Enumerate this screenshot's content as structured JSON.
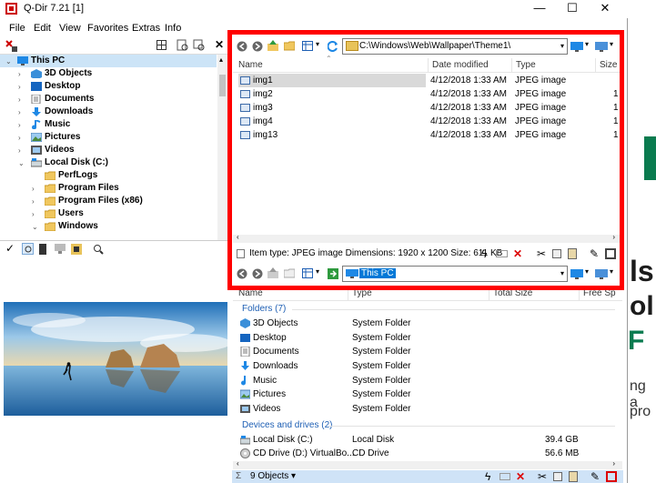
{
  "window": {
    "title": "Q-Dir 7.21 [1]",
    "minimize": "—",
    "maximize": "☐",
    "close": "✕"
  },
  "menu": [
    "File",
    "Edit",
    "View",
    "Favorites",
    "Extras",
    "Info"
  ],
  "tree": {
    "items": [
      {
        "label": "This PC",
        "level": 0,
        "expanded": true,
        "selected": true,
        "icon": "monitor-icon"
      },
      {
        "label": "3D Objects",
        "level": 1,
        "icon": "cube-icon"
      },
      {
        "label": "Desktop",
        "level": 1,
        "icon": "desktop-icon"
      },
      {
        "label": "Documents",
        "level": 1,
        "icon": "documents-icon"
      },
      {
        "label": "Downloads",
        "level": 1,
        "icon": "download-arrow-icon"
      },
      {
        "label": "Music",
        "level": 1,
        "icon": "music-note-icon"
      },
      {
        "label": "Pictures",
        "level": 1,
        "icon": "pictures-icon"
      },
      {
        "label": "Videos",
        "level": 1,
        "icon": "videos-icon"
      },
      {
        "label": "Local Disk (C:)",
        "level": 1,
        "expanded": true,
        "icon": "drive-icon"
      },
      {
        "label": "PerfLogs",
        "level": 2,
        "icon": "folder-icon"
      },
      {
        "label": "Program Files",
        "level": 2,
        "icon": "folder-icon"
      },
      {
        "label": "Program Files (x86)",
        "level": 2,
        "icon": "folder-icon"
      },
      {
        "label": "Users",
        "level": 2,
        "icon": "folder-icon"
      },
      {
        "label": "Windows",
        "level": 2,
        "expanded": true,
        "icon": "folder-icon"
      }
    ]
  },
  "pane1": {
    "address": "C:\\Windows\\Web\\Wallpaper\\Theme1\\",
    "columns": [
      "Name",
      "Date modified",
      "Type",
      "Size"
    ],
    "files": [
      {
        "name": "img1",
        "date": "4/12/2018 1:33 AM",
        "type": "JPEG image",
        "size": ""
      },
      {
        "name": "img2",
        "date": "4/12/2018 1:33 AM",
        "type": "JPEG image",
        "size": "1"
      },
      {
        "name": "img3",
        "date": "4/12/2018 1:33 AM",
        "type": "JPEG image",
        "size": "1"
      },
      {
        "name": "img4",
        "date": "4/12/2018 1:33 AM",
        "type": "JPEG image",
        "size": "1"
      },
      {
        "name": "img13",
        "date": "4/12/2018 1:33 AM",
        "type": "JPEG image",
        "size": "1"
      }
    ],
    "status": "Item type: JPEG image Dimensions: 1920 x 1200 Size: 611 KB"
  },
  "pane2": {
    "address": "This PC",
    "columns": [
      "Name",
      "Type",
      "Total Size",
      "Free Sp"
    ],
    "group_folders": "Folders (7)",
    "folders": [
      {
        "name": "3D Objects",
        "type": "System Folder",
        "icon": "cube-icon"
      },
      {
        "name": "Desktop",
        "type": "System Folder",
        "icon": "desktop-icon"
      },
      {
        "name": "Documents",
        "type": "System Folder",
        "icon": "documents-icon"
      },
      {
        "name": "Downloads",
        "type": "System Folder",
        "icon": "download-arrow-icon"
      },
      {
        "name": "Music",
        "type": "System Folder",
        "icon": "music-note-icon"
      },
      {
        "name": "Pictures",
        "type": "System Folder",
        "icon": "pictures-icon"
      },
      {
        "name": "Videos",
        "type": "System Folder",
        "icon": "videos-icon"
      }
    ],
    "group_drives": "Devices and drives (2)",
    "drives": [
      {
        "name": "Local Disk (C:)",
        "type": "Local Disk",
        "total": "39.4 GB",
        "icon": "drive-icon"
      },
      {
        "name": "CD Drive (D:) VirtualBo...",
        "type": "CD Drive",
        "total": "56.6 MB",
        "icon": "cd-drive-icon"
      }
    ],
    "status": "9 Objects ▾"
  },
  "background_text": {
    "a": "ls",
    "b": "ol",
    "c": "F",
    "d": "ng a",
    "e": "pro"
  },
  "colors": {
    "highlight_box": "#ff0000",
    "selection": "#cce4f7",
    "address_selected": "#0078d7",
    "group_header": "#1e5fb4"
  }
}
